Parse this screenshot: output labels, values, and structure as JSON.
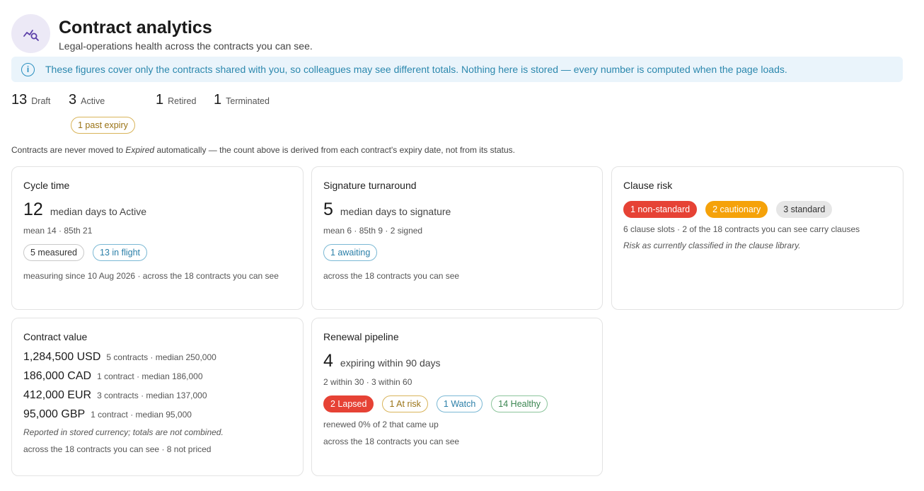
{
  "header": {
    "title": "Contract analytics",
    "subtitle": "Legal-operations health across the contracts you can see."
  },
  "banner": {
    "text": "These figures cover only the contracts shared with you, so colleagues may see different totals. Nothing here is stored — every number is computed when the page loads."
  },
  "status_counts": [
    {
      "count": "13",
      "label": "Draft"
    },
    {
      "count": "3",
      "label": "Active"
    },
    {
      "count": "1",
      "label": "Retired"
    },
    {
      "count": "1",
      "label": "Terminated"
    }
  ],
  "past_expiry_badge": "1 past expiry",
  "note": {
    "before": "Contracts are never moved to ",
    "em": "Expired",
    "after": " automatically — the count above is derived from each contract's expiry date, not from its status."
  },
  "cycle_time": {
    "title": "Cycle time",
    "value": "12",
    "label": "median days to Active",
    "meta": "mean 14 · 85th 21",
    "pills": [
      "5 measured",
      "13 in flight"
    ],
    "footer": "measuring since 10 Aug 2026 · across the 18 contracts you can see"
  },
  "signature": {
    "title": "Signature turnaround",
    "value": "5",
    "label": "median days to signature",
    "meta": "mean 6 · 85th 9 · 2 signed",
    "pills": [
      "1 awaiting"
    ],
    "footer": "across the 18 contracts you can see"
  },
  "clause_risk": {
    "title": "Clause risk",
    "pills": [
      "1 non-standard",
      "2 cautionary",
      "3 standard"
    ],
    "meta": "6 clause slots · 2 of the 18 contracts you can see carry clauses",
    "italic_note": "Risk as currently classified in the clause library."
  },
  "contract_value": {
    "title": "Contract value",
    "rows": [
      {
        "amount": "1,284,500 USD",
        "detail": "5 contracts · median 250,000"
      },
      {
        "amount": "186,000 CAD",
        "detail": "1 contract · median 186,000"
      },
      {
        "amount": "412,000 EUR",
        "detail": "3 contracts · median 137,000"
      },
      {
        "amount": "95,000 GBP",
        "detail": "1 contract · median 95,000"
      }
    ],
    "italic_note": "Reported in stored currency; totals are not combined.",
    "footer": "across the 18 contracts you can see · 8 not priced"
  },
  "renewal": {
    "title": "Renewal pipeline",
    "value": "4",
    "label": "expiring within 90 days",
    "meta": "2 within 30 · 3 within 60",
    "pills": [
      "2 Lapsed",
      "1 At risk",
      "1 Watch",
      "14 Healthy"
    ],
    "renewed": "renewed 0% of 2 that came up",
    "footer": "across the 18 contracts you can see"
  },
  "colors": {
    "accent_purple": "#5b3fa8",
    "info_blue": "#2c88ae",
    "danger_red": "#e64235",
    "caution_orange": "#f5a20a"
  }
}
